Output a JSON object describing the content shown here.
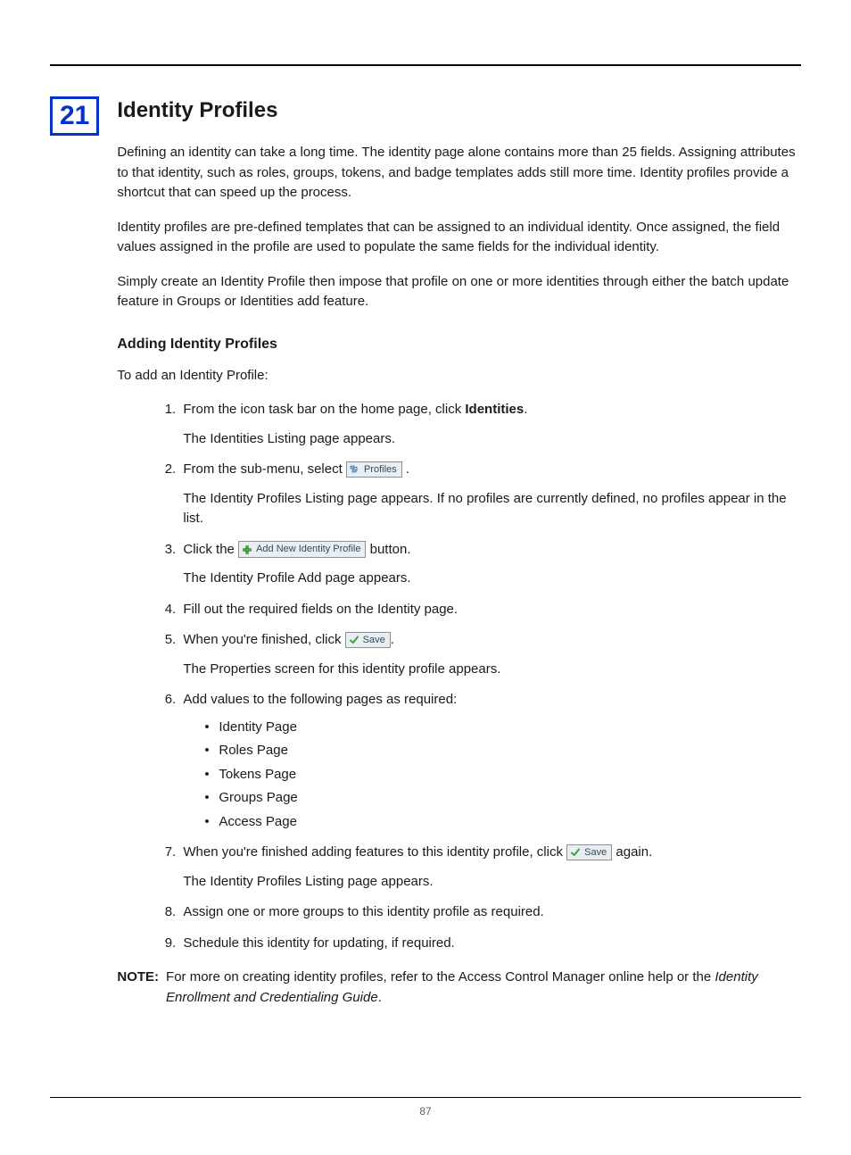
{
  "chapter_number": "21",
  "page_number": "87",
  "heading": "Identity Profiles",
  "intro_para_1": "Defining an identity can take a long time. The identity page alone contains more than 25 fields. Assigning attributes to that identity, such as roles, groups, tokens, and badge templates adds still more time. Identity profiles provide a shortcut that can speed up the process.",
  "intro_para_2": "Identity profiles are pre-defined templates that can be assigned to an individual identity. Once assigned, the field values assigned in the profile are used to populate the same fields for the individual identity.",
  "intro_para_3": "Simply create an Identity Profile then impose that profile on one or more identities through either the batch update feature in Groups or Identities add feature.",
  "sub_heading": "Adding Identity Profiles",
  "sub_intro": "To add an Identity Profile:",
  "steps": {
    "s1_a": "From the icon task bar on the home page, click ",
    "s1_b": "Identities",
    "s1_c": ".",
    "s1_result": "The Identities Listing page appears.",
    "s2_a": "From the sub-menu, select ",
    "s2_btn": "Profiles",
    "s2_c": ".",
    "s2_result": "The Identity Profiles Listing page appears. If no profiles are currently defined, no profiles appear in the list.",
    "s3_a": "Click the ",
    "s3_btn": "Add New Identity Profile",
    "s3_c": " button.",
    "s3_result": "The Identity Profile Add page appears.",
    "s4": "Fill out the required fields on the Identity page.",
    "s5_a": "When you're finished, click ",
    "s5_btn": "Save",
    "s5_c": ".",
    "s5_result": "The Properties screen for this identity profile appears.",
    "s6": "Add values to the following pages as required:",
    "s6_items": [
      "Identity Page",
      "Roles Page",
      "Tokens Page",
      "Groups Page",
      "Access Page"
    ],
    "s7_a": "When you're finished adding features to this identity profile, click ",
    "s7_btn": "Save",
    "s7_c": " again.",
    "s7_result": "The Identity Profiles Listing page appears.",
    "s8": "Assign one or more groups to this identity profile as required.",
    "s9": "Schedule this identity for updating, if required."
  },
  "note_label": "NOTE:",
  "note_a": "For more on creating identity profiles, refer to the Access Control Manager online help or the ",
  "note_b": "Identity Enrollment and Credentialing Guide",
  "note_c": "."
}
